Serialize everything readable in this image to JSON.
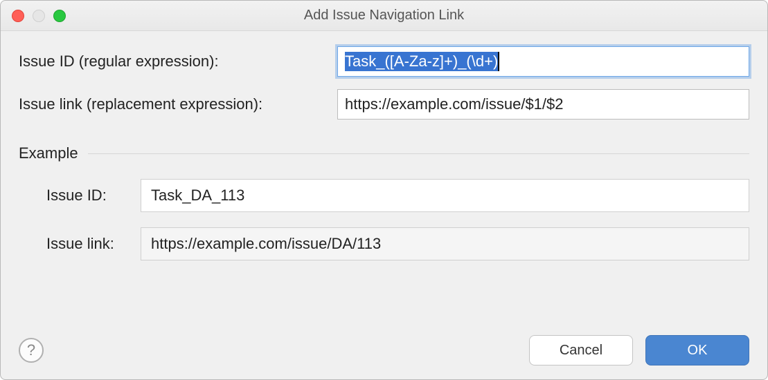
{
  "window": {
    "title": "Add Issue Navigation Link"
  },
  "fields": {
    "issue_id_label": "Issue ID (regular expression):",
    "issue_id_value": "Task_([A-Za-z]+)_(\\d+)",
    "issue_link_label": "Issue link (replacement expression):",
    "issue_link_value": "https://example.com/issue/$1/$2"
  },
  "example": {
    "section_label": "Example",
    "id_label": "Issue ID:",
    "id_value": "Task_DA_113",
    "link_label": "Issue link:",
    "link_value": "https://example.com/issue/DA/113"
  },
  "buttons": {
    "cancel": "Cancel",
    "ok": "OK",
    "help": "?"
  }
}
